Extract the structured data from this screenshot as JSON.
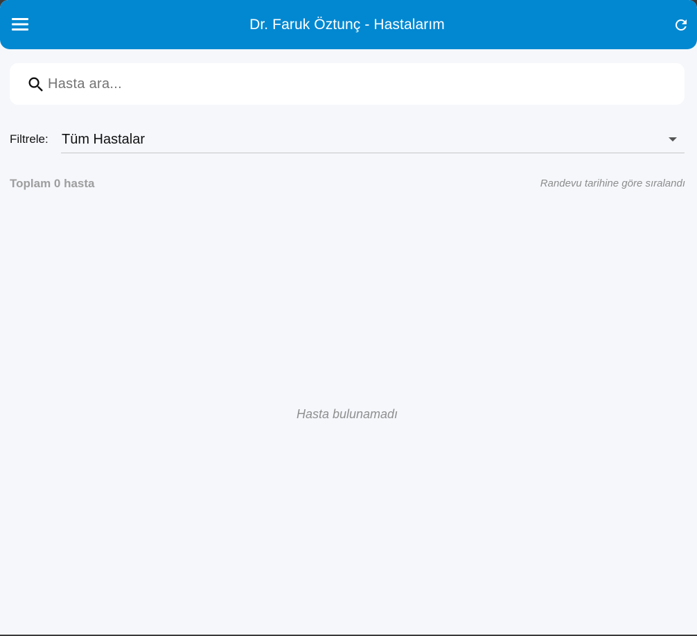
{
  "appbar": {
    "title": "Dr. Faruk Öztunç - Hastalarım",
    "menu_icon": "menu-icon",
    "refresh_icon": "refresh-icon",
    "background_color": "#0288d1"
  },
  "search": {
    "placeholder": "Hasta ara...",
    "value": "",
    "icon": "search-icon"
  },
  "filter": {
    "label": "Filtrele:",
    "selected": "Tüm Hastalar"
  },
  "summary": {
    "total": "Toplam 0 hasta",
    "sort_note": "Randevu tarihine göre sıralandı"
  },
  "patients": [],
  "empty_message": "Hasta bulunamadı"
}
